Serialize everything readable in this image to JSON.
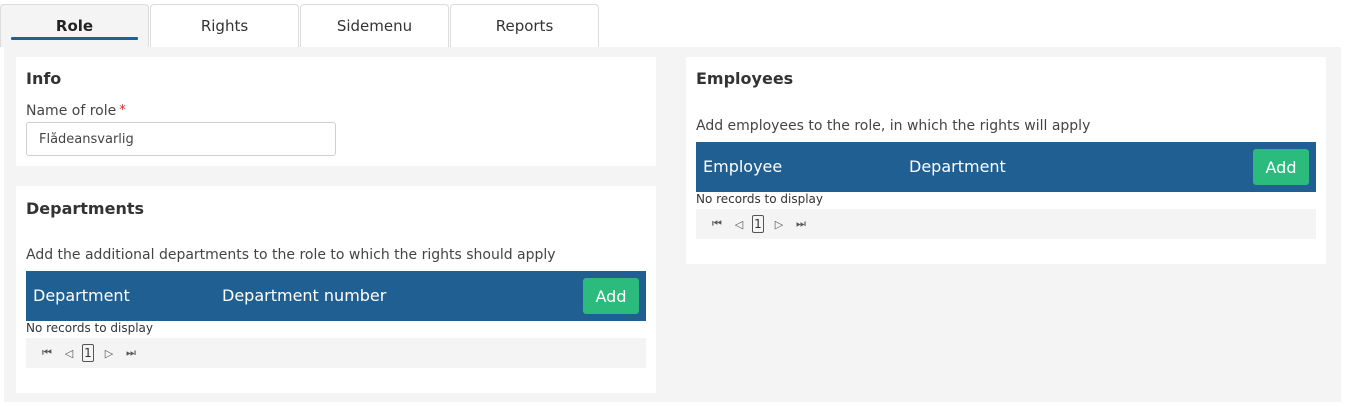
{
  "tabs": [
    {
      "label": "Role",
      "active": true
    },
    {
      "label": "Rights",
      "active": false
    },
    {
      "label": "Sidemenu",
      "active": false
    },
    {
      "label": "Reports",
      "active": false
    }
  ],
  "info": {
    "title": "Info",
    "name_label": "Name of role",
    "required_mark": "*",
    "name_value": "Flådeansvarlig"
  },
  "departments": {
    "title": "Departments",
    "description": "Add the additional departments to the role to which the rights should apply",
    "columns": [
      "Department",
      "Department number"
    ],
    "add_label": "Add",
    "no_records": "No records to display",
    "pager": {
      "first": "⏮",
      "prev": "◁",
      "page": "1",
      "next": "▷",
      "last": "⏭"
    }
  },
  "employees": {
    "title": "Employees",
    "description": "Add employees to the role, in which the rights will apply",
    "columns": [
      "Employee",
      "Department"
    ],
    "add_label": "Add",
    "no_records": "No records to display",
    "pager": {
      "first": "⏮",
      "prev": "◁",
      "page": "1",
      "next": "▷",
      "last": "⏭"
    }
  },
  "colors": {
    "grid_header": "#1f5f91",
    "add_button": "#2bbb7d",
    "tab_underline": "#1e5f96",
    "required": "#d9262c"
  }
}
